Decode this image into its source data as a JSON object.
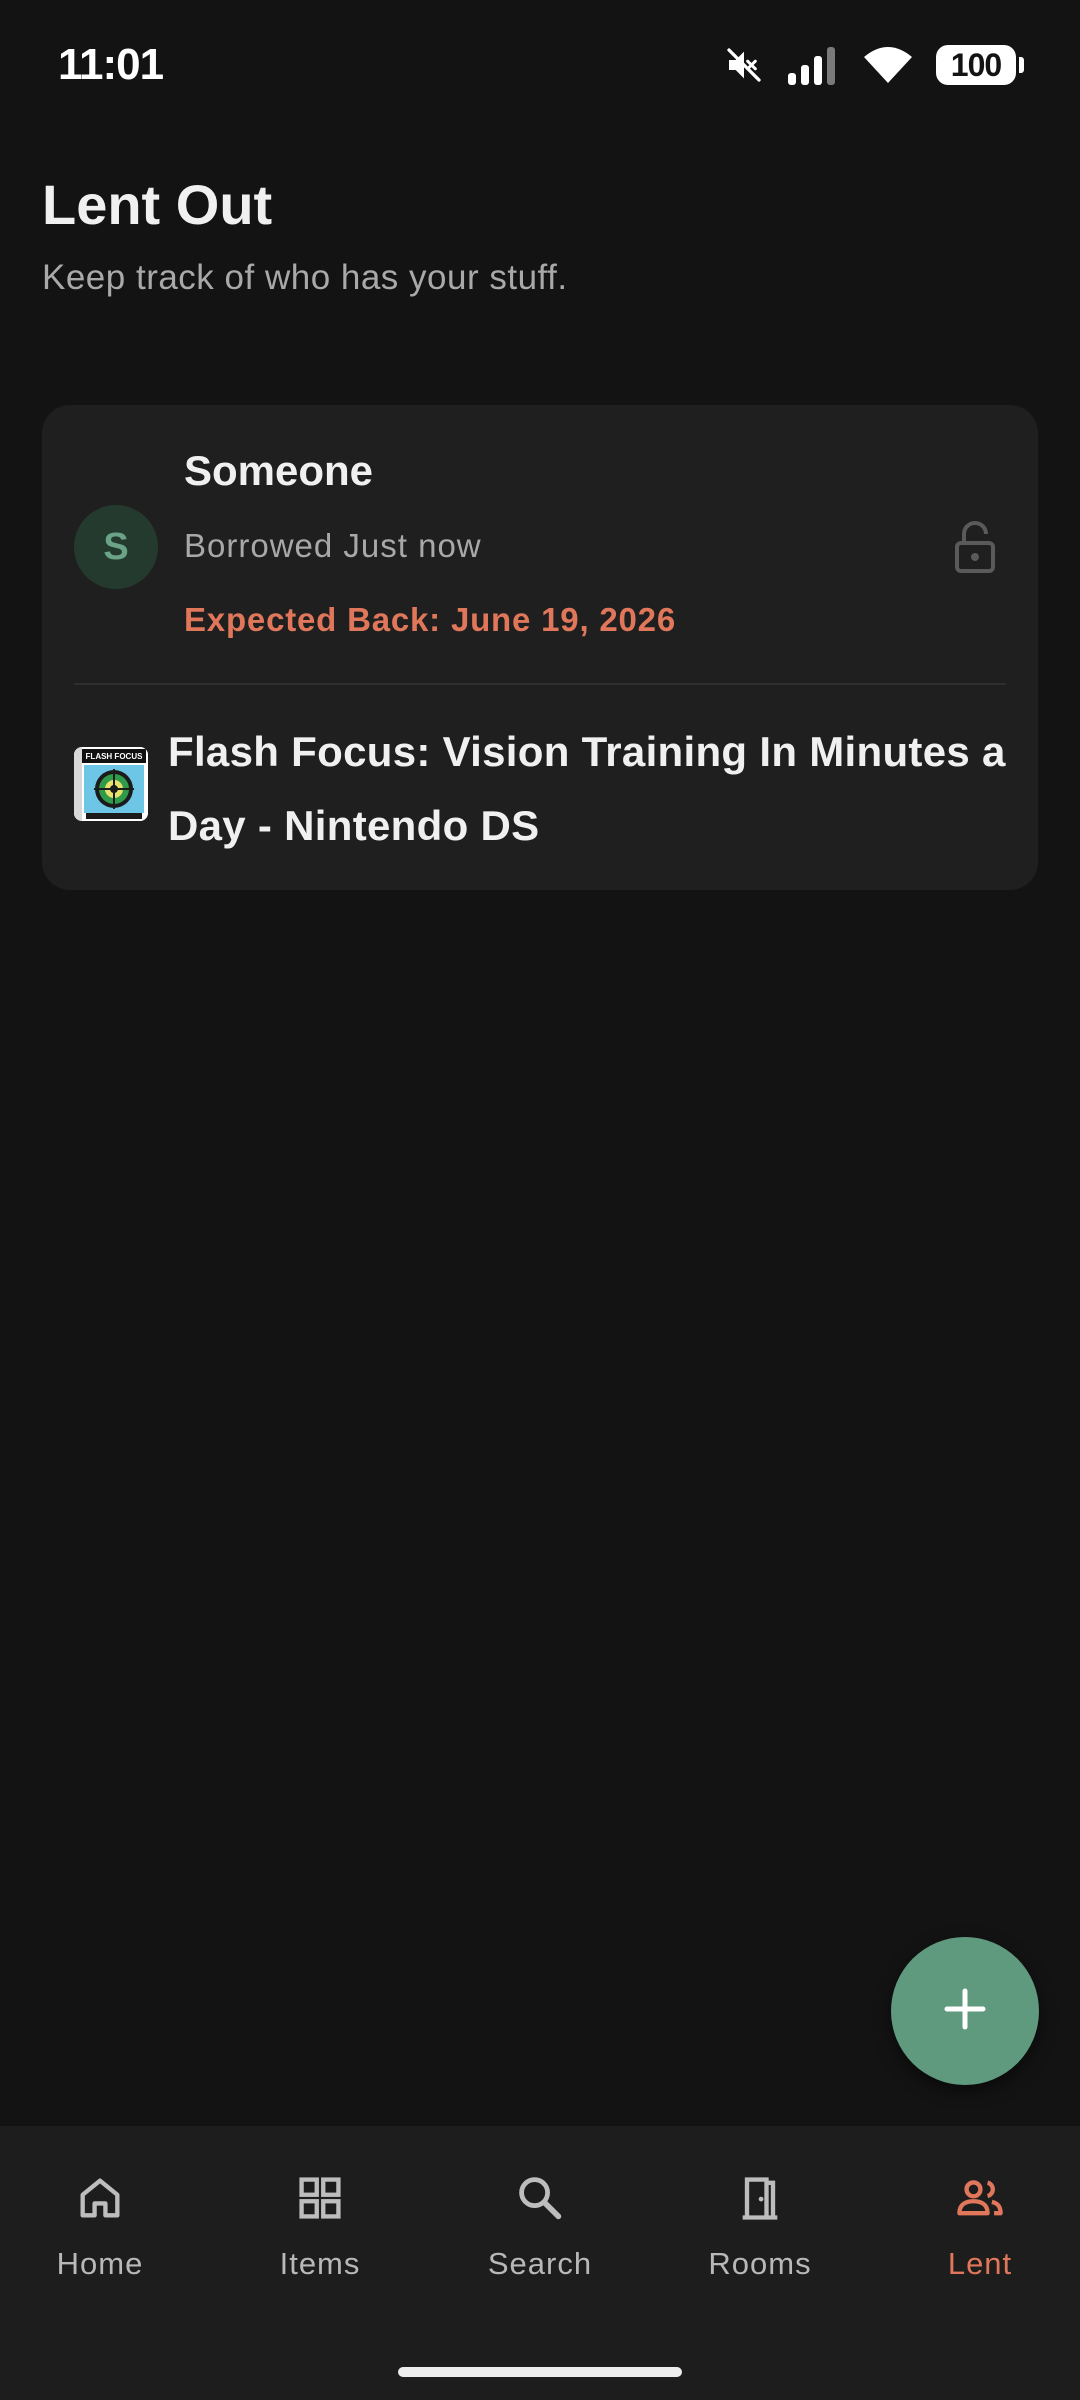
{
  "status_bar": {
    "time": "11:01",
    "battery": "100",
    "icons": [
      "mute-icon",
      "signal-icon",
      "wifi-icon",
      "battery-icon"
    ]
  },
  "header": {
    "title": "Lent Out",
    "subtitle": "Keep track of who has your stuff."
  },
  "loans": [
    {
      "avatar_initial": "S",
      "borrower": "Someone",
      "borrowed": "Borrowed Just now",
      "expected_back": "Expected Back: June 19, 2026",
      "item_title": "Flash Focus: Vision Training In Minutes a Day - Nintendo DS",
      "thumb_label": "FLASH FOCUS",
      "lock_icon": "unlock-icon"
    }
  ],
  "fab": {
    "icon": "plus-icon"
  },
  "nav": {
    "items": [
      {
        "label": "Home",
        "icon": "home-icon"
      },
      {
        "label": "Items",
        "icon": "grid-icon"
      },
      {
        "label": "Search",
        "icon": "search-icon"
      },
      {
        "label": "Rooms",
        "icon": "door-icon"
      },
      {
        "label": "Lent",
        "icon": "people-icon"
      }
    ],
    "active": "Lent"
  },
  "colors": {
    "background": "#131313",
    "card": "#1f1f1f",
    "accent": "#e0775a",
    "fab": "#5f9a7f",
    "avatar_bg": "#243a2f",
    "avatar_text": "#6aa386"
  }
}
